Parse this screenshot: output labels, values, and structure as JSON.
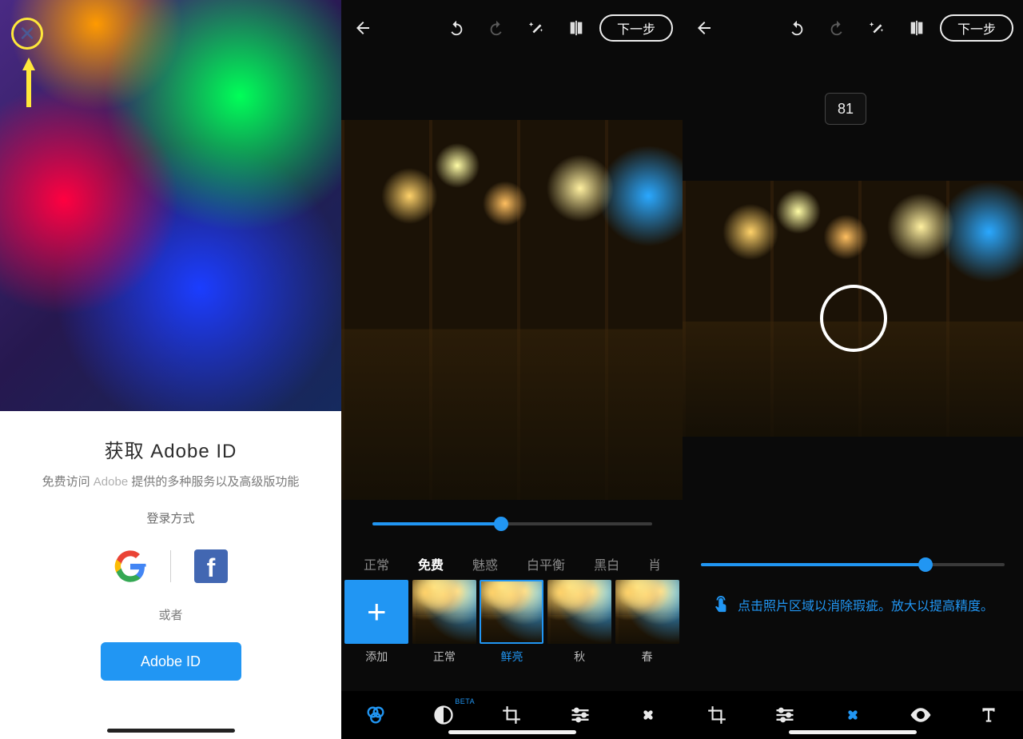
{
  "panel1": {
    "title": "获取 Adobe ID",
    "subtitle_prefix": "免费访问 ",
    "subtitle_brand": "Adobe ",
    "subtitle_suffix": "提供的多种服务以及高级版功能",
    "login_label": "登录方式",
    "or_label": "或者",
    "id_button": "Adobe ID",
    "social_icons": {
      "google": "google-logo-icon",
      "facebook": "facebook-logo-icon"
    },
    "highlight_color": "#ffe83a"
  },
  "shared_toolbar": {
    "next_label": "下一步"
  },
  "panel2": {
    "slider_pct": 46,
    "categories": [
      "正常",
      "免费",
      "魅惑",
      "白平衡",
      "黑白",
      "肖"
    ],
    "active_category_index": 1,
    "filters": [
      {
        "label": "添加",
        "type": "add"
      },
      {
        "label": "正常"
      },
      {
        "label": "鲜亮",
        "active": true
      },
      {
        "label": "秋"
      },
      {
        "label": "春"
      }
    ],
    "tabs": [
      "looks",
      "effects",
      "crop",
      "adjust",
      "heal"
    ],
    "active_tab_index": 0,
    "beta_label": "BETA"
  },
  "panel3": {
    "badge_value": "81",
    "slider_pct": 74,
    "hint_text": "点击照片区域以消除瑕疵。放大以提高精度。",
    "tabs": [
      "crop",
      "adjust",
      "heal",
      "eye",
      "text"
    ],
    "active_tab_index": 2
  },
  "colors": {
    "accent": "#2196f3"
  }
}
